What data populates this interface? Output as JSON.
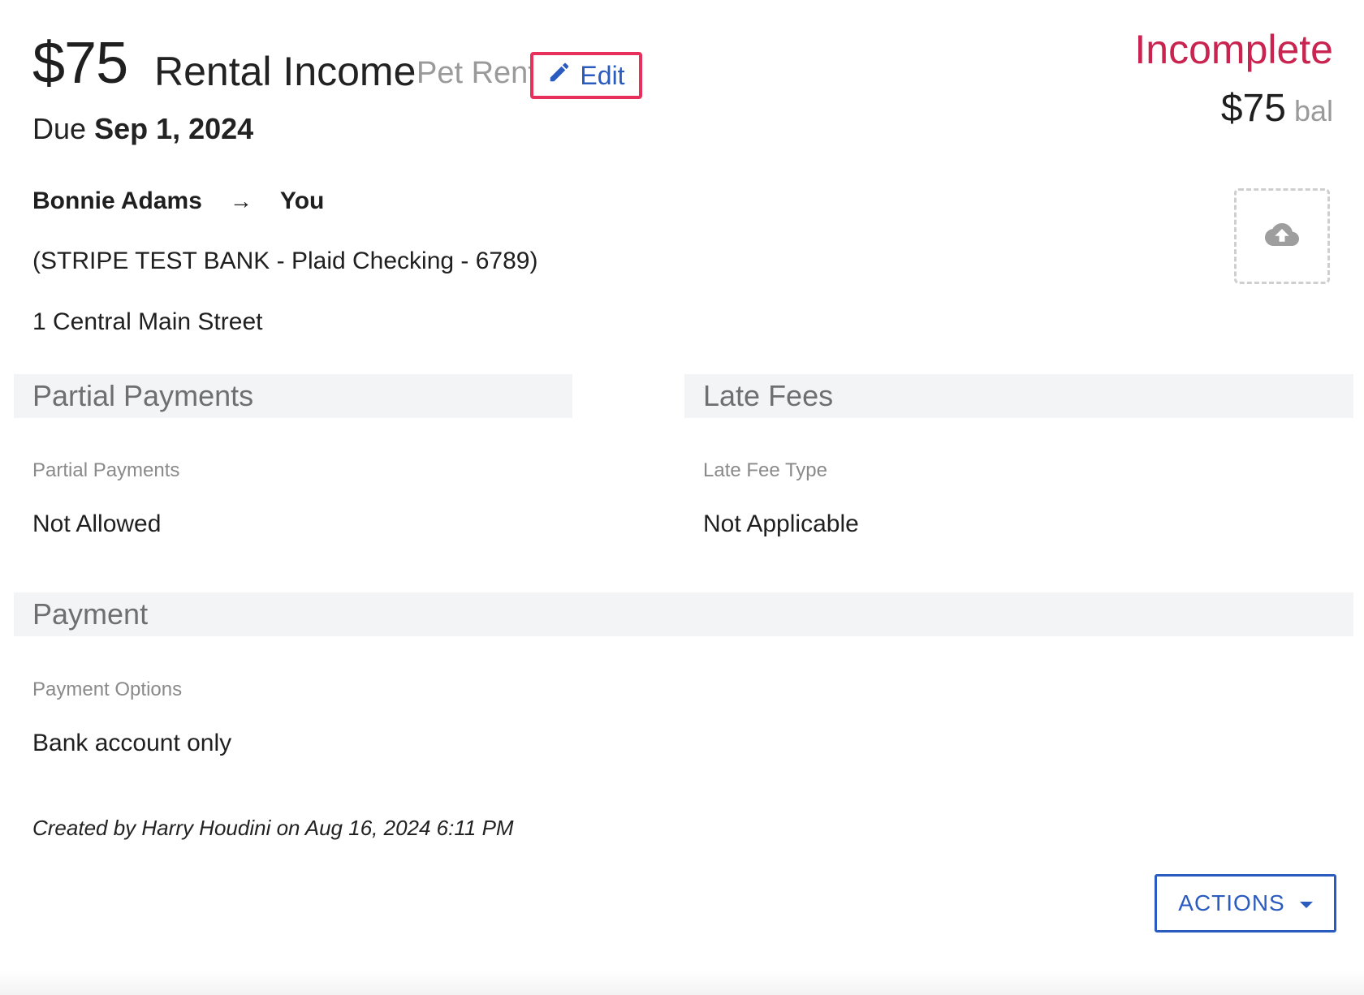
{
  "header": {
    "amount": "$75",
    "title": "Rental Income",
    "category": "Pet Rent",
    "edit_label": "Edit",
    "due_prefix": "Due",
    "due_date": "Sep 1, 2024"
  },
  "summary": {
    "status": "Incomplete",
    "status_color": "#c8244f",
    "balance_amount": "$75",
    "balance_suffix": "bal"
  },
  "parties": {
    "from": "Bonnie Adams",
    "arrow": "→",
    "to": "You",
    "bank": "(STRIPE TEST BANK - Plaid Checking - 6789)",
    "address": "1 Central Main Street"
  },
  "upload": {
    "icon": "cloud-upload-icon"
  },
  "sections": {
    "partial": {
      "title": "Partial Payments",
      "label": "Partial Payments",
      "value": "Not Allowed"
    },
    "late": {
      "title": "Late Fees",
      "label": "Late Fee Type",
      "value": "Not Applicable"
    },
    "payment": {
      "title": "Payment",
      "label": "Payment Options",
      "value": "Bank account only"
    }
  },
  "footer": {
    "created": "Created by Harry Houdini on Aug 16, 2024 6:11 PM",
    "actions_label": "ACTIONS"
  },
  "colors": {
    "accent": "#2a5bbf",
    "highlight_border": "#e8305c",
    "section_bg": "#f3f4f6"
  }
}
